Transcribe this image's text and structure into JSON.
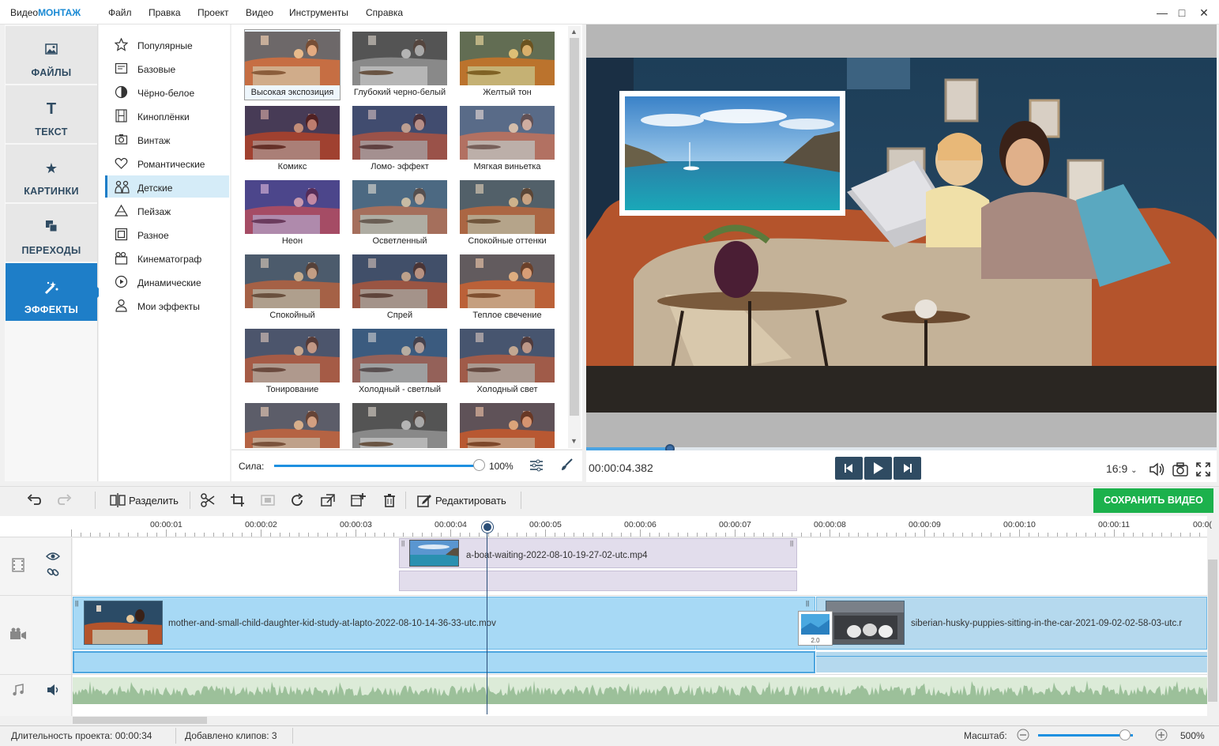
{
  "app": {
    "name_part1": "Видео",
    "name_part2": "МОНТАЖ",
    "menu": [
      "Файл",
      "Правка",
      "Проект",
      "Видео",
      "Инструменты",
      "Справка"
    ]
  },
  "nav": {
    "tabs": [
      {
        "label": "ФАЙЛЫ",
        "icon": "image-icon"
      },
      {
        "label": "ТЕКСТ",
        "icon": "text-icon"
      },
      {
        "label": "КАРТИНКИ",
        "icon": "star-icon"
      },
      {
        "label": "ПЕРЕХОДЫ",
        "icon": "transitions-icon"
      },
      {
        "label": "ЭФФЕКТЫ",
        "icon": "effects-icon",
        "active": true
      }
    ]
  },
  "categories": [
    {
      "label": "Популярные",
      "icon": "star-outline-icon"
    },
    {
      "label": "Базовые",
      "icon": "basic-icon"
    },
    {
      "label": "Чёрно-белое",
      "icon": "bw-icon"
    },
    {
      "label": "Киноплёнки",
      "icon": "film-icon"
    },
    {
      "label": "Винтаж",
      "icon": "camera-icon"
    },
    {
      "label": "Романтические",
      "icon": "heart-icon"
    },
    {
      "label": "Детские",
      "icon": "kids-icon",
      "active": true
    },
    {
      "label": "Пейзаж",
      "icon": "landscape-icon"
    },
    {
      "label": "Разное",
      "icon": "misc-icon"
    },
    {
      "label": "Кинематограф",
      "icon": "cinema-icon"
    },
    {
      "label": "Динамические",
      "icon": "play-circle-icon"
    },
    {
      "label": "Мои эффекты",
      "icon": "user-icon"
    }
  ],
  "effects": [
    {
      "label": "Высокая экспозиция",
      "tint": "#e8a070",
      "selected": true
    },
    {
      "label": "Глубокий черно-белый",
      "tint": "bw"
    },
    {
      "label": "Желтый тон",
      "tint": "#c8b030"
    },
    {
      "label": "Комикс",
      "tint": "#7a1f3a"
    },
    {
      "label": "Ломо- эффект",
      "tint": "#6a5080"
    },
    {
      "label": "Мягкая виньетка",
      "tint": "#b0a8c8"
    },
    {
      "label": "Неон",
      "tint": "#8a40d0"
    },
    {
      "label": "Осветленный",
      "tint": "#8aa4b8"
    },
    {
      "label": "Спокойные оттенки",
      "tint": "#9a8a70"
    },
    {
      "label": "Спокойный",
      "tint": "#8a7a78"
    },
    {
      "label": "Спрей",
      "tint": "#6a5870"
    },
    {
      "label": "Теплое свечение",
      "tint": "#c87a50"
    },
    {
      "label": "Тонирование",
      "tint": "#8a6a78"
    },
    {
      "label": "Холодный - светлый",
      "tint": "#5a7ab0"
    },
    {
      "label": "Холодный свет",
      "tint": "#7a6a80"
    },
    {
      "label": "",
      "tint": "#b88070"
    },
    {
      "label": "",
      "tint": "bw"
    },
    {
      "label": "",
      "tint": "#c06040"
    }
  ],
  "strength": {
    "label": "Сила:",
    "value_text": "100%",
    "value": 1.0
  },
  "player": {
    "timecode": "00:00:04.382",
    "progress": 0.133,
    "aspect": "16:9"
  },
  "toolbar": {
    "split_label": "Разделить",
    "edit_label": "Редактировать",
    "save_label": "СОХРАНИТЬ ВИДЕО"
  },
  "ruler": {
    "ticks": [
      "00:00:01",
      "00:00:02",
      "00:00:03",
      "00:00:04",
      "00:00:05",
      "00:00:06",
      "00:00:07",
      "00:00:08",
      "00:00:09",
      "00:00:10",
      "00:00:11",
      "00:0("
    ]
  },
  "timeline": {
    "overlay_clip": "a-boat-waiting-2022-08-10-19-27-02-utc.mp4",
    "main_clip_1": "mother-and-small-child-daughter-kid-study-at-lapto-2022-08-10-14-36-33-utc.mov",
    "main_clip_2": "siberian-husky-puppies-sitting-in-the-car-2021-09-02-02-58-03-utc.r",
    "transition_duration": "2.0"
  },
  "status": {
    "duration": "Длительность проекта:  00:00:34",
    "clips": "Добавлено клипов: 3",
    "zoom_label": "Масштаб:",
    "zoom_value": "500%",
    "zoom_level": 0.92
  },
  "colors": {
    "accent": "#1e7ec8",
    "save": "#1cb14c",
    "dark": "#2f4b62"
  }
}
